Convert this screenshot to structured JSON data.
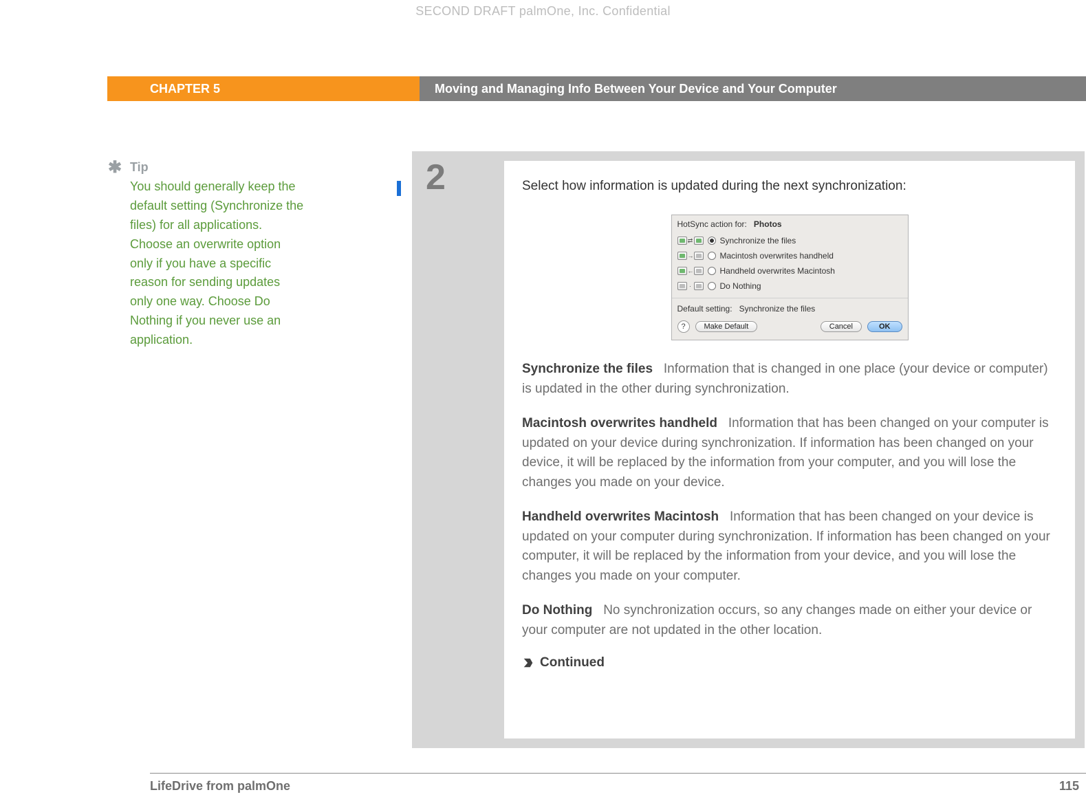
{
  "watermark": "SECOND DRAFT palmOne, Inc.  Confidential",
  "header": {
    "chapter": "CHAPTER 5",
    "title": "Moving and Managing Info Between Your Device and Your Computer"
  },
  "tip": {
    "label": "Tip",
    "body": "You should generally keep the default setting (Synchronize the files) for all applications. Choose an overwrite option only if you have a specific reason for sending updates only one way. Choose Do Nothing if you never use an application."
  },
  "step": {
    "number": "2",
    "lead": "Select how information is updated during the next synchronization:"
  },
  "dialog": {
    "head_label": "HotSync action for:",
    "head_value": "Photos",
    "options": [
      {
        "label": "Synchronize the files",
        "checked": true
      },
      {
        "label": "Macintosh overwrites handheld",
        "checked": false
      },
      {
        "label": "Handheld overwrites Macintosh",
        "checked": false
      },
      {
        "label": "Do Nothing",
        "checked": false
      }
    ],
    "default_label": "Default setting:",
    "default_value": "Synchronize the files",
    "buttons": {
      "help": "?",
      "make_default": "Make Default",
      "cancel": "Cancel",
      "ok": "OK"
    }
  },
  "definitions": {
    "sync_title": "Synchronize the files",
    "sync_body": "Information that is changed in one place (your device or computer) is updated in the other during synchronization.",
    "mac_title": "Macintosh overwrites handheld",
    "mac_body": "Information that has been changed on your computer is updated on your device during synchronization. If information has been changed on your device, it will be replaced by the information from your computer, and you will lose the changes you made on your device.",
    "hh_title": "Handheld overwrites Macintosh",
    "hh_body": "Information that has been changed on your device is updated on your computer during synchronization. If information has been changed on your computer, it will be replaced by the information from your device, and you will lose the changes you made on your computer.",
    "dn_title": "Do Nothing",
    "dn_body": "No synchronization occurs, so any changes made on either your device or your computer are not updated in the other location."
  },
  "continued": "Continued",
  "footer": {
    "product": "LifeDrive from palmOne",
    "page": "115"
  }
}
